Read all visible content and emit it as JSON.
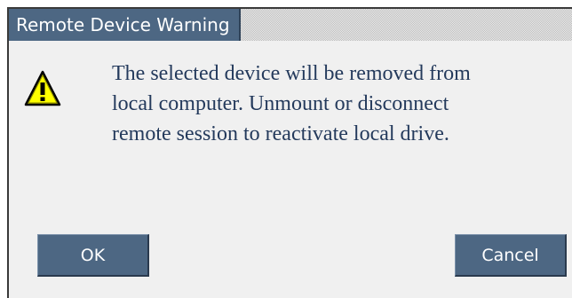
{
  "dialog": {
    "title": "Remote Device Warning",
    "message_lines": [
      "The selected device will be removed from",
      "local computer. Unmount or disconnect",
      "remote session to reactivate local drive."
    ],
    "icon": "warning-icon",
    "ok_label": "OK",
    "cancel_label": "Cancel"
  },
  "colors": {
    "title_bg": "#4d6783",
    "button_bg": "#4d6783",
    "text": "#243a5c",
    "dialog_bg": "#f0f0f0",
    "warning_yellow": "#ffff00"
  }
}
